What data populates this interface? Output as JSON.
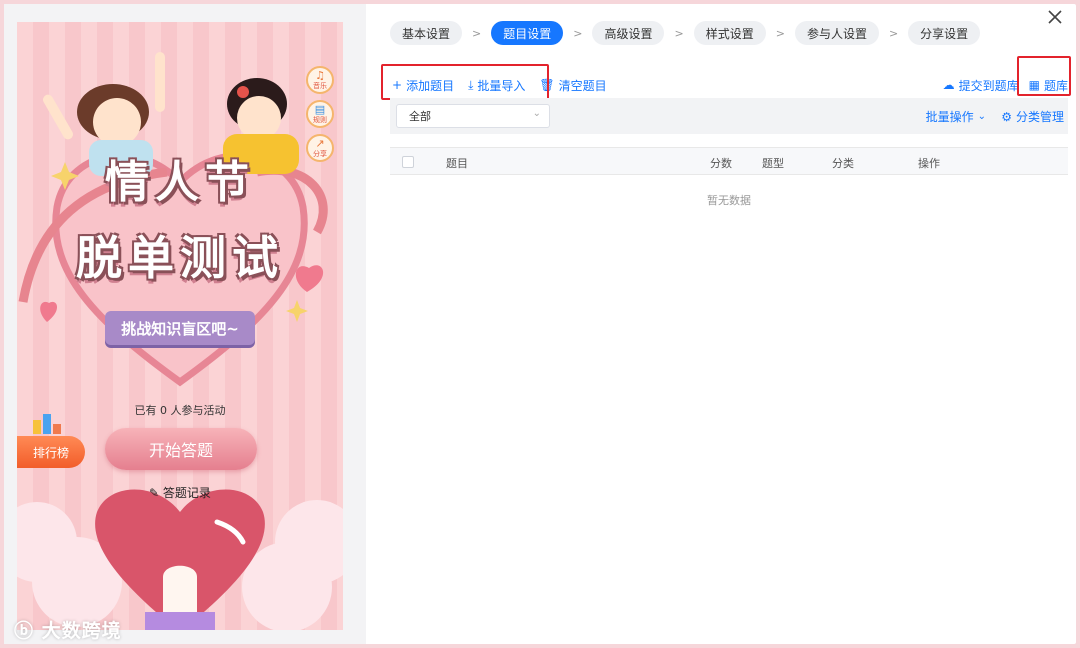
{
  "preview": {
    "side_icons": [
      "音乐",
      "规则",
      "分享"
    ],
    "title_line1": "情人节",
    "title_line2": "脱单测试",
    "ribbon": "挑战知识盲区吧~",
    "participants": "已有 0 人参与活动",
    "start_button": "开始答题",
    "leaderboard": "排行榜",
    "records_link": "答题记录",
    "watermark": "大数跨境"
  },
  "steps": [
    "基本设置",
    "题目设置",
    "高级设置",
    "样式设置",
    "参与人设置",
    "分享设置"
  ],
  "active_step": "题目设置",
  "toolbar": {
    "add_question": "添加题目",
    "batch_import": "批量导入",
    "clear_questions": "清空题目",
    "submit_to_bank": "提交到题库",
    "question_bank": "题库"
  },
  "filter": {
    "selected": "全部",
    "batch_operations": "批量操作",
    "category_management": "分类管理"
  },
  "table": {
    "columns": [
      "题目",
      "分数",
      "题型",
      "分类",
      "操作"
    ],
    "empty_text": "暂无数据"
  },
  "colors": {
    "primary": "#1677ff",
    "highlight_box": "#e3232c",
    "start_button": "#e57f8f"
  }
}
